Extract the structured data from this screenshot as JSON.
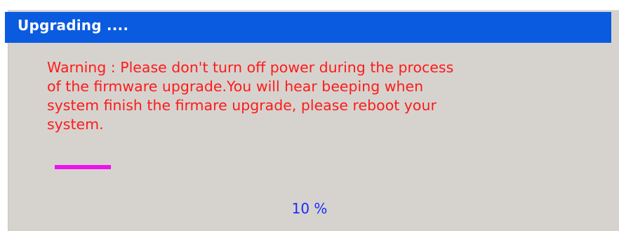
{
  "dialog": {
    "title": "Upgrading ....",
    "warning_lines": [
      "Warning : Please don't turn off power during the process",
      "of the firmware upgrade.You will hear beeping when",
      "system finish the firmare upgrade, please reboot your",
      "system."
    ],
    "progress_text": "10 %",
    "progress_percent": 10
  },
  "colors": {
    "title_bar": "#0a5be0",
    "panel_background": "#d6d3ce",
    "warning_text": "#ff1a1a",
    "progress_text": "#1b2bff",
    "annotation_underline": "#ee12ee"
  }
}
